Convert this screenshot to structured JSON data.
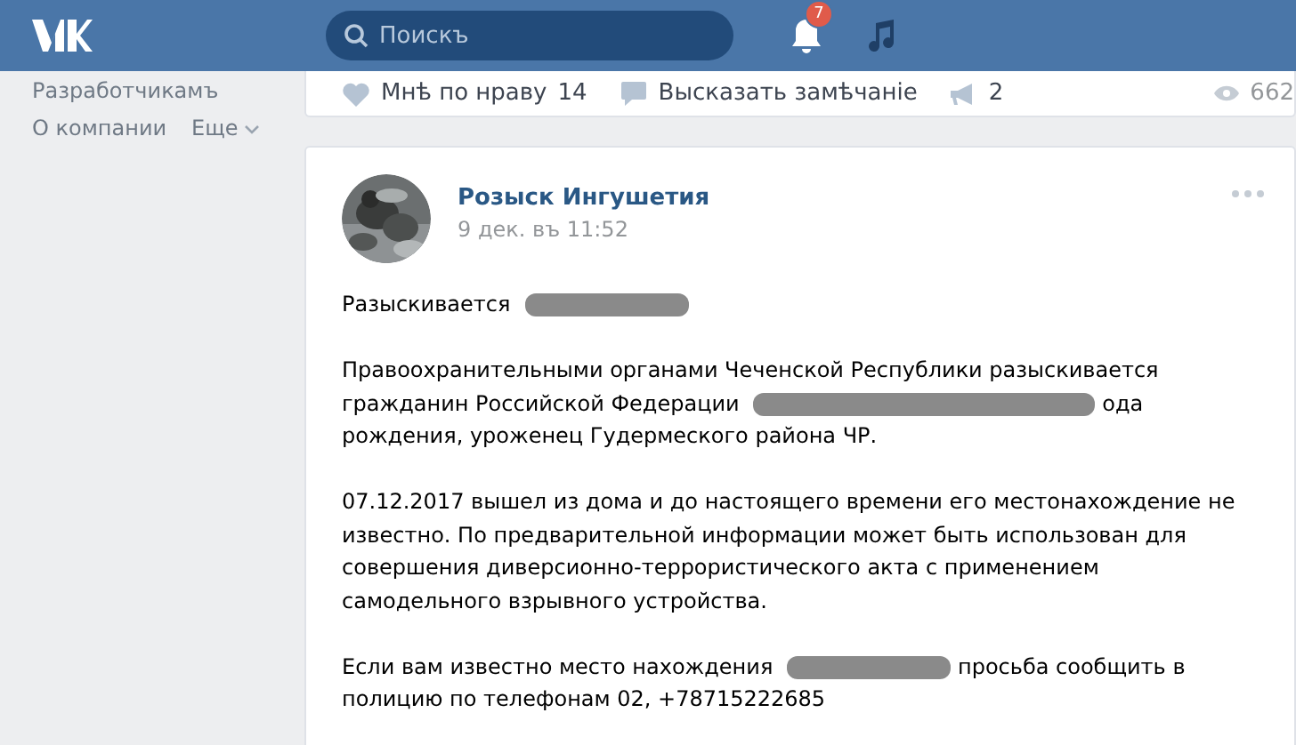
{
  "header": {
    "search": {
      "placeholder": "Поискъ"
    },
    "notifications_badge": "7"
  },
  "sidebar": {
    "items": [
      {
        "label": "Разработчикамъ",
        "kind": "link"
      },
      {
        "label": "О компании",
        "kind": "link"
      },
      {
        "label": "Еще",
        "kind": "more"
      }
    ]
  },
  "previous_post": {
    "actions": [
      {
        "kind": "like",
        "label": "Мнѣ по нраву",
        "count": "14"
      },
      {
        "kind": "comment",
        "label": "Высказать замѣчаніе"
      },
      {
        "kind": "share",
        "count": "2"
      }
    ],
    "views": "662"
  },
  "post": {
    "author": "Розыск Ингушетия",
    "date": "9 дек. въ 11:52",
    "avatar": {
      "kind": "picture"
    },
    "paragraphs": [
      [
        {
          "text": "Разыскивается"
        },
        {
          "kind": "redaction",
          "wide": false
        }
      ],
      [
        {
          "text": "Правоохранительными органами Чеченской Республики разыскивается гражданин Российской Федерации"
        },
        {
          "kind": "redaction",
          "wide": true
        },
        {
          "text": "ода рождения, уроженец Гудермеского района ЧР."
        }
      ],
      [
        {
          "text": "07.12.2017 вышел из дома и до настоящего времени его местонахождение не известно. По предварительной информации может быть использован для совершения диверсионно-террористического акта с применением самодельного взрывного устройства."
        }
      ],
      [
        {
          "text": "Если вам известно место нахождения"
        },
        {
          "kind": "redaction",
          "wide": false
        },
        {
          "text": "просьба сообщить в полицию по телефонам 02, +78715222685"
        }
      ]
    ]
  }
}
